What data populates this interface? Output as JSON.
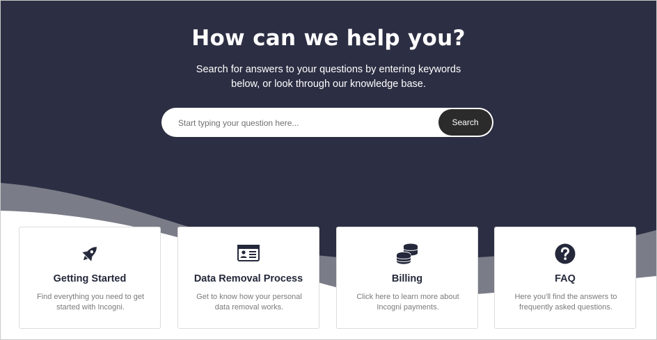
{
  "hero": {
    "title": "How can we help you?",
    "subtitle": "Search for answers to your questions by entering keywords below, or look through our knowledge base.",
    "colors": {
      "background": "#2c2e43",
      "wave": "#7a7c88"
    }
  },
  "search": {
    "placeholder": "Start typing your question here...",
    "button_label": "Search"
  },
  "cards": [
    {
      "icon": "rocket-icon",
      "title": "Getting Started",
      "description": "Find everything you need to get started with Incogni."
    },
    {
      "icon": "id-card-icon",
      "title": "Data Removal Process",
      "description": "Get to know how your personal data removal works."
    },
    {
      "icon": "coins-icon",
      "title": "Billing",
      "description": "Click here to learn more about Incogni payments."
    },
    {
      "icon": "question-circle-icon",
      "title": "FAQ",
      "description": "Here you'll find the answers to frequently asked questions."
    }
  ]
}
